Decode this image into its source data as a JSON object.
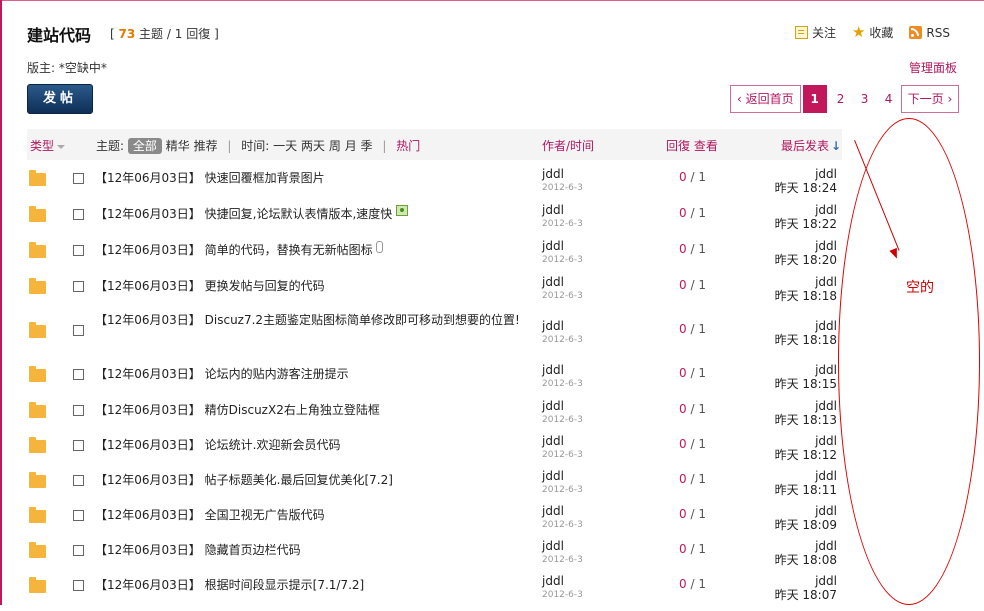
{
  "forum": {
    "title": "建站代码",
    "stats_open": "[",
    "topic_count": "73",
    "topics_label": "主题",
    "slash": "/",
    "reply_count": "1",
    "replies_label": "回復",
    "stats_close": "]",
    "moderator": "版主: *空缺中*",
    "manage": "管理面板"
  },
  "actions": {
    "follow": "关注",
    "favorite": "收藏",
    "rss": "RSS",
    "post": "发帖"
  },
  "pager": {
    "home": "‹ 返回首页",
    "pages": [
      "1",
      "2",
      "3",
      "4"
    ],
    "current": "1",
    "next": "下一页 ›"
  },
  "list_header": {
    "type": "类型",
    "topic_label": "主题:",
    "all": "全部",
    "digest": "精华",
    "sticky": "推荐",
    "time_label": "时间:",
    "day": "一天",
    "two_days": "两天",
    "week": "周",
    "month": "月",
    "quarter": "季",
    "hot": "热门",
    "author_time": "作者/时间",
    "replies": "回復",
    "views": "查看",
    "last_post": "最后发表",
    "sort_arrow": "↓"
  },
  "threads": [
    {
      "date_tag": "【12年06月03日】",
      "title": "快速回覆框加背景图片",
      "author": "jddl",
      "post_date": "2012-6-3",
      "replies": "0",
      "views": "1",
      "last_user": "jddl",
      "last_time": "昨天 18:24"
    },
    {
      "date_tag": "【12年06月03日】",
      "title": "快捷回复,论坛默认表情版本,速度快",
      "author": "jddl",
      "post_date": "2012-6-3",
      "replies": "0",
      "views": "1",
      "last_user": "jddl",
      "last_time": "昨天 18:22",
      "icon": "image-attachment-icon"
    },
    {
      "date_tag": "【12年06月03日】",
      "title": "简单的代码，替换有无新帖图标",
      "author": "jddl",
      "post_date": "2012-6-3",
      "replies": "0",
      "views": "1",
      "last_user": "jddl",
      "last_time": "昨天 18:20",
      "icon": "paperclip-icon"
    },
    {
      "date_tag": "【12年06月03日】",
      "title": "更换发帖与回复的代码",
      "author": "jddl",
      "post_date": "2012-6-3",
      "replies": "0",
      "views": "1",
      "last_user": "jddl",
      "last_time": "昨天 18:18"
    },
    {
      "date_tag": "【12年06月03日】",
      "title": "Discuz7.2主题鉴定贴图标简单修改即可移动到想要的位置!",
      "author": "jddl",
      "post_date": "2012-6-3",
      "replies": "0",
      "views": "1",
      "last_user": "jddl",
      "last_time": "昨天 18:18"
    },
    {
      "date_tag": "【12年06月03日】",
      "title": "论坛内的贴内游客注册提示",
      "author": "jddl",
      "post_date": "2012-6-3",
      "replies": "0",
      "views": "1",
      "last_user": "jddl",
      "last_time": "昨天 18:15"
    },
    {
      "date_tag": "【12年06月03日】",
      "title": "精仿DiscuzX2右上角独立登陆框",
      "author": "jddl",
      "post_date": "2012-6-3",
      "replies": "0",
      "views": "1",
      "last_user": "jddl",
      "last_time": "昨天 18:13"
    },
    {
      "date_tag": "【12年06月03日】",
      "title": "论坛统计.欢迎新会员代码",
      "author": "jddl",
      "post_date": "2012-6-3",
      "replies": "0",
      "views": "1",
      "last_user": "jddl",
      "last_time": "昨天 18:12"
    },
    {
      "date_tag": "【12年06月03日】",
      "title": "帖子标题美化.最后回复优美化[7.2]",
      "author": "jddl",
      "post_date": "2012-6-3",
      "replies": "0",
      "views": "1",
      "last_user": "jddl",
      "last_time": "昨天 18:11"
    },
    {
      "date_tag": "【12年06月03日】",
      "title": "全国卫视无广告版代码",
      "author": "jddl",
      "post_date": "2012-6-3",
      "replies": "0",
      "views": "1",
      "last_user": "jddl",
      "last_time": "昨天 18:09"
    },
    {
      "date_tag": "【12年06月03日】",
      "title": "隐藏首页边栏代码",
      "author": "jddl",
      "post_date": "2012-6-3",
      "replies": "0",
      "views": "1",
      "last_user": "jddl",
      "last_time": "昨天 18:08"
    },
    {
      "date_tag": "【12年06月03日】",
      "title": "根据时间段显示提示[7.1/7.2]",
      "author": "jddl",
      "post_date": "2012-6-3",
      "replies": "0",
      "views": "1",
      "last_user": "jddl",
      "last_time": "昨天 18:07"
    }
  ],
  "annotation": {
    "text": "空的",
    "color": "#d00000"
  },
  "colors": {
    "accent": "#b0175f",
    "current_page": "#c2185b",
    "post_button": "#0d2f57",
    "folder": "#f5b53c"
  }
}
